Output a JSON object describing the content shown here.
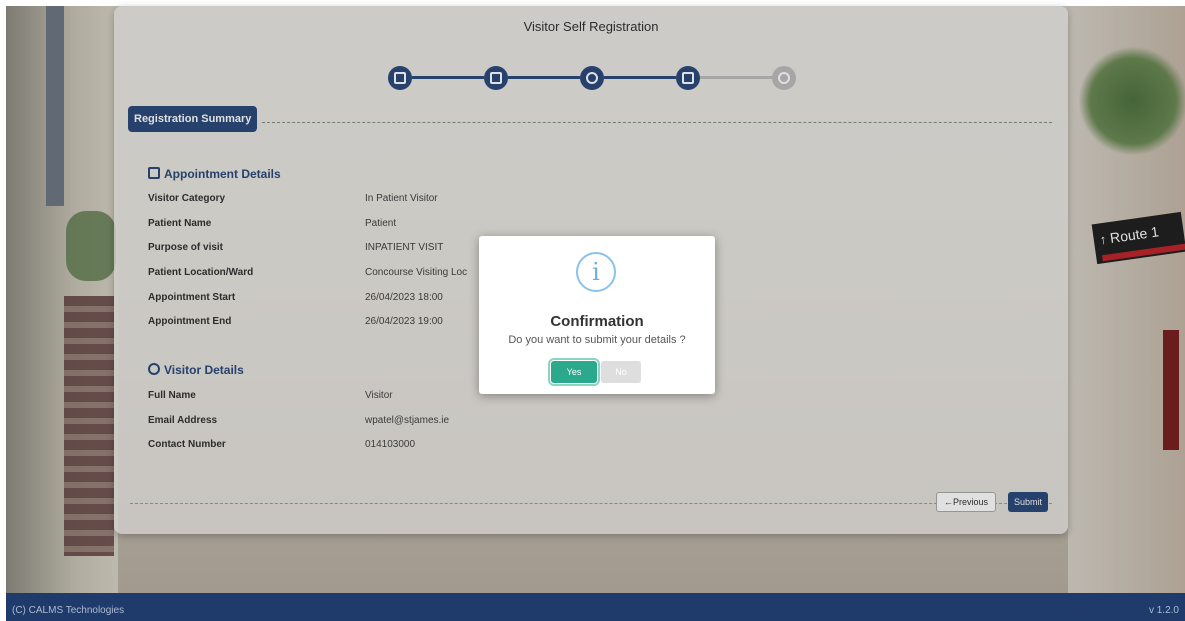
{
  "page_title": "Visitor Self Registration",
  "stepper": {
    "steps": [
      {
        "icon": "document-icon",
        "status": "complete"
      },
      {
        "icon": "calendar-icon",
        "status": "complete"
      },
      {
        "icon": "user-icon",
        "status": "complete"
      },
      {
        "icon": "list-icon",
        "status": "current"
      },
      {
        "icon": "check-icon",
        "status": "pending"
      }
    ]
  },
  "section_tab": "Registration Summary",
  "appointment": {
    "title": "Appointment Details",
    "fields": [
      {
        "label": "Visitor Category",
        "value": "In Patient Visitor"
      },
      {
        "label": "Patient Name",
        "value": "Patient"
      },
      {
        "label": "Purpose of visit",
        "value": "INPATIENT VISIT"
      },
      {
        "label": "Patient Location/Ward",
        "value": "Concourse Visiting Loc"
      },
      {
        "label": "Appointment Start",
        "value": "26/04/2023 18:00"
      },
      {
        "label": "Appointment End",
        "value": "26/04/2023 19:00"
      }
    ]
  },
  "visitor": {
    "title": "Visitor Details",
    "fields": [
      {
        "label": "Full Name",
        "value": "Visitor"
      },
      {
        "label": "Email Address",
        "value": "wpatel@stjames.ie"
      },
      {
        "label": "Contact Number",
        "value": "014103000"
      }
    ]
  },
  "buttons": {
    "previous": "←Previous",
    "submit": "Submit"
  },
  "modal": {
    "icon": "info-icon",
    "icon_glyph": "i",
    "title": "Confirmation",
    "message": "Do you want to submit your details ?",
    "yes": "Yes",
    "no": "No"
  },
  "background_sign": {
    "text": "Route 1",
    "arrow": "↑"
  },
  "footer": {
    "copyright": "(C) CALMS Technologies",
    "version": "v 1.2.0"
  },
  "colors": {
    "primary": "#2c4a7c",
    "confirm": "#2aa98d",
    "footer": "#1f3b6b",
    "info": "#89c3e8"
  }
}
